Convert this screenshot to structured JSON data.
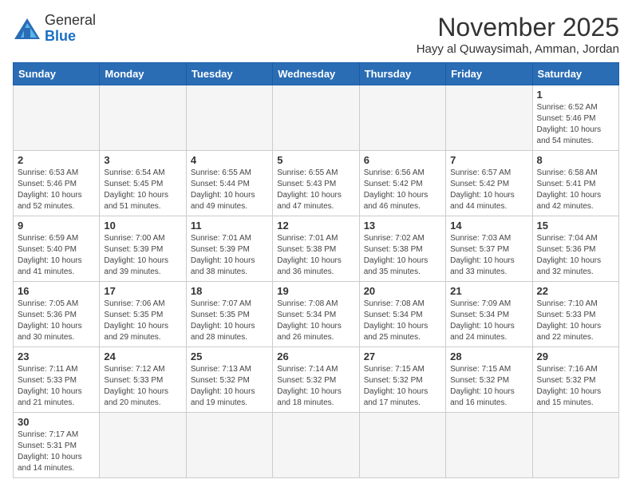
{
  "header": {
    "logo_general": "General",
    "logo_blue": "Blue",
    "month_title": "November 2025",
    "location": "Hayy al Quwaysimah, Amman, Jordan"
  },
  "weekdays": [
    "Sunday",
    "Monday",
    "Tuesday",
    "Wednesday",
    "Thursday",
    "Friday",
    "Saturday"
  ],
  "weeks": [
    [
      {
        "day": "",
        "info": ""
      },
      {
        "day": "",
        "info": ""
      },
      {
        "day": "",
        "info": ""
      },
      {
        "day": "",
        "info": ""
      },
      {
        "day": "",
        "info": ""
      },
      {
        "day": "",
        "info": ""
      },
      {
        "day": "1",
        "info": "Sunrise: 6:52 AM\nSunset: 5:46 PM\nDaylight: 10 hours\nand 54 minutes."
      }
    ],
    [
      {
        "day": "2",
        "info": "Sunrise: 6:53 AM\nSunset: 5:46 PM\nDaylight: 10 hours\nand 52 minutes."
      },
      {
        "day": "3",
        "info": "Sunrise: 6:54 AM\nSunset: 5:45 PM\nDaylight: 10 hours\nand 51 minutes."
      },
      {
        "day": "4",
        "info": "Sunrise: 6:55 AM\nSunset: 5:44 PM\nDaylight: 10 hours\nand 49 minutes."
      },
      {
        "day": "5",
        "info": "Sunrise: 6:55 AM\nSunset: 5:43 PM\nDaylight: 10 hours\nand 47 minutes."
      },
      {
        "day": "6",
        "info": "Sunrise: 6:56 AM\nSunset: 5:42 PM\nDaylight: 10 hours\nand 46 minutes."
      },
      {
        "day": "7",
        "info": "Sunrise: 6:57 AM\nSunset: 5:42 PM\nDaylight: 10 hours\nand 44 minutes."
      },
      {
        "day": "8",
        "info": "Sunrise: 6:58 AM\nSunset: 5:41 PM\nDaylight: 10 hours\nand 42 minutes."
      }
    ],
    [
      {
        "day": "9",
        "info": "Sunrise: 6:59 AM\nSunset: 5:40 PM\nDaylight: 10 hours\nand 41 minutes."
      },
      {
        "day": "10",
        "info": "Sunrise: 7:00 AM\nSunset: 5:39 PM\nDaylight: 10 hours\nand 39 minutes."
      },
      {
        "day": "11",
        "info": "Sunrise: 7:01 AM\nSunset: 5:39 PM\nDaylight: 10 hours\nand 38 minutes."
      },
      {
        "day": "12",
        "info": "Sunrise: 7:01 AM\nSunset: 5:38 PM\nDaylight: 10 hours\nand 36 minutes."
      },
      {
        "day": "13",
        "info": "Sunrise: 7:02 AM\nSunset: 5:38 PM\nDaylight: 10 hours\nand 35 minutes."
      },
      {
        "day": "14",
        "info": "Sunrise: 7:03 AM\nSunset: 5:37 PM\nDaylight: 10 hours\nand 33 minutes."
      },
      {
        "day": "15",
        "info": "Sunrise: 7:04 AM\nSunset: 5:36 PM\nDaylight: 10 hours\nand 32 minutes."
      }
    ],
    [
      {
        "day": "16",
        "info": "Sunrise: 7:05 AM\nSunset: 5:36 PM\nDaylight: 10 hours\nand 30 minutes."
      },
      {
        "day": "17",
        "info": "Sunrise: 7:06 AM\nSunset: 5:35 PM\nDaylight: 10 hours\nand 29 minutes."
      },
      {
        "day": "18",
        "info": "Sunrise: 7:07 AM\nSunset: 5:35 PM\nDaylight: 10 hours\nand 28 minutes."
      },
      {
        "day": "19",
        "info": "Sunrise: 7:08 AM\nSunset: 5:34 PM\nDaylight: 10 hours\nand 26 minutes."
      },
      {
        "day": "20",
        "info": "Sunrise: 7:08 AM\nSunset: 5:34 PM\nDaylight: 10 hours\nand 25 minutes."
      },
      {
        "day": "21",
        "info": "Sunrise: 7:09 AM\nSunset: 5:34 PM\nDaylight: 10 hours\nand 24 minutes."
      },
      {
        "day": "22",
        "info": "Sunrise: 7:10 AM\nSunset: 5:33 PM\nDaylight: 10 hours\nand 22 minutes."
      }
    ],
    [
      {
        "day": "23",
        "info": "Sunrise: 7:11 AM\nSunset: 5:33 PM\nDaylight: 10 hours\nand 21 minutes."
      },
      {
        "day": "24",
        "info": "Sunrise: 7:12 AM\nSunset: 5:33 PM\nDaylight: 10 hours\nand 20 minutes."
      },
      {
        "day": "25",
        "info": "Sunrise: 7:13 AM\nSunset: 5:32 PM\nDaylight: 10 hours\nand 19 minutes."
      },
      {
        "day": "26",
        "info": "Sunrise: 7:14 AM\nSunset: 5:32 PM\nDaylight: 10 hours\nand 18 minutes."
      },
      {
        "day": "27",
        "info": "Sunrise: 7:15 AM\nSunset: 5:32 PM\nDaylight: 10 hours\nand 17 minutes."
      },
      {
        "day": "28",
        "info": "Sunrise: 7:15 AM\nSunset: 5:32 PM\nDaylight: 10 hours\nand 16 minutes."
      },
      {
        "day": "29",
        "info": "Sunrise: 7:16 AM\nSunset: 5:32 PM\nDaylight: 10 hours\nand 15 minutes."
      }
    ],
    [
      {
        "day": "30",
        "info": "Sunrise: 7:17 AM\nSunset: 5:31 PM\nDaylight: 10 hours\nand 14 minutes."
      },
      {
        "day": "",
        "info": ""
      },
      {
        "day": "",
        "info": ""
      },
      {
        "day": "",
        "info": ""
      },
      {
        "day": "",
        "info": ""
      },
      {
        "day": "",
        "info": ""
      },
      {
        "day": "",
        "info": ""
      }
    ]
  ]
}
